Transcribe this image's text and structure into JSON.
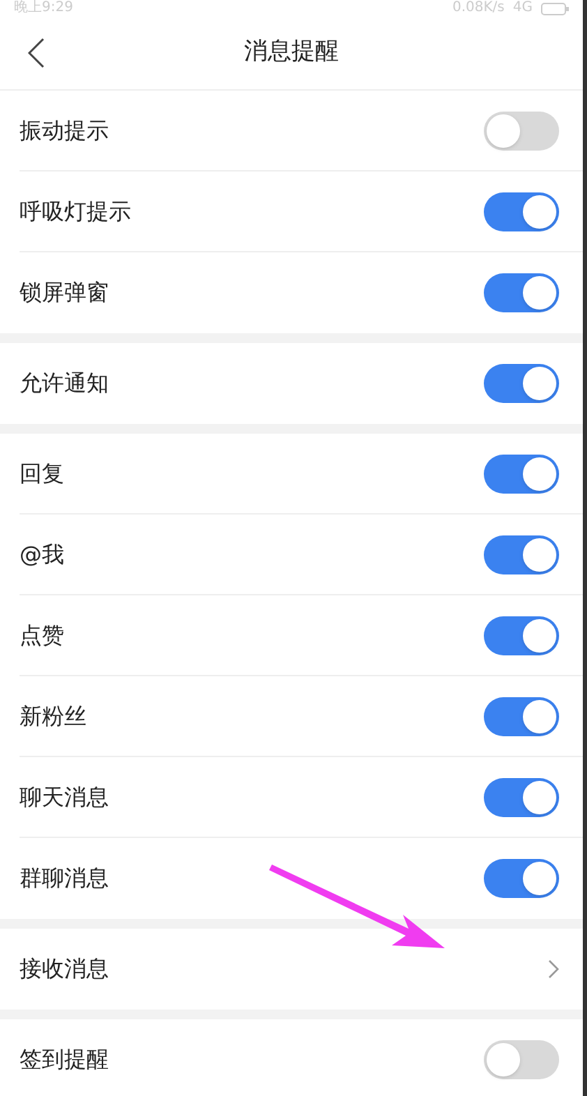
{
  "status_bar": {
    "time": "晚上9:29",
    "speed": "0.08K/s",
    "network": "4G"
  },
  "header": {
    "title": "消息提醒"
  },
  "sections": [
    {
      "items": [
        {
          "label": "振动提示",
          "kind": "toggle",
          "on": false
        },
        {
          "label": "呼吸灯提示",
          "kind": "toggle",
          "on": true
        },
        {
          "label": "锁屏弹窗",
          "kind": "toggle",
          "on": true
        }
      ]
    },
    {
      "items": [
        {
          "label": "允许通知",
          "kind": "toggle",
          "on": true
        }
      ]
    },
    {
      "items": [
        {
          "label": "回复",
          "kind": "toggle",
          "on": true
        },
        {
          "label": "@我",
          "kind": "toggle",
          "on": true
        },
        {
          "label": "点赞",
          "kind": "toggle",
          "on": true
        },
        {
          "label": "新粉丝",
          "kind": "toggle",
          "on": true
        },
        {
          "label": "聊天消息",
          "kind": "toggle",
          "on": true
        },
        {
          "label": "群聊消息",
          "kind": "toggle",
          "on": true
        }
      ]
    },
    {
      "items": [
        {
          "label": "接收消息",
          "kind": "link"
        }
      ]
    },
    {
      "items": [
        {
          "label": "签到提醒",
          "kind": "toggle",
          "on": false
        }
      ]
    }
  ]
}
